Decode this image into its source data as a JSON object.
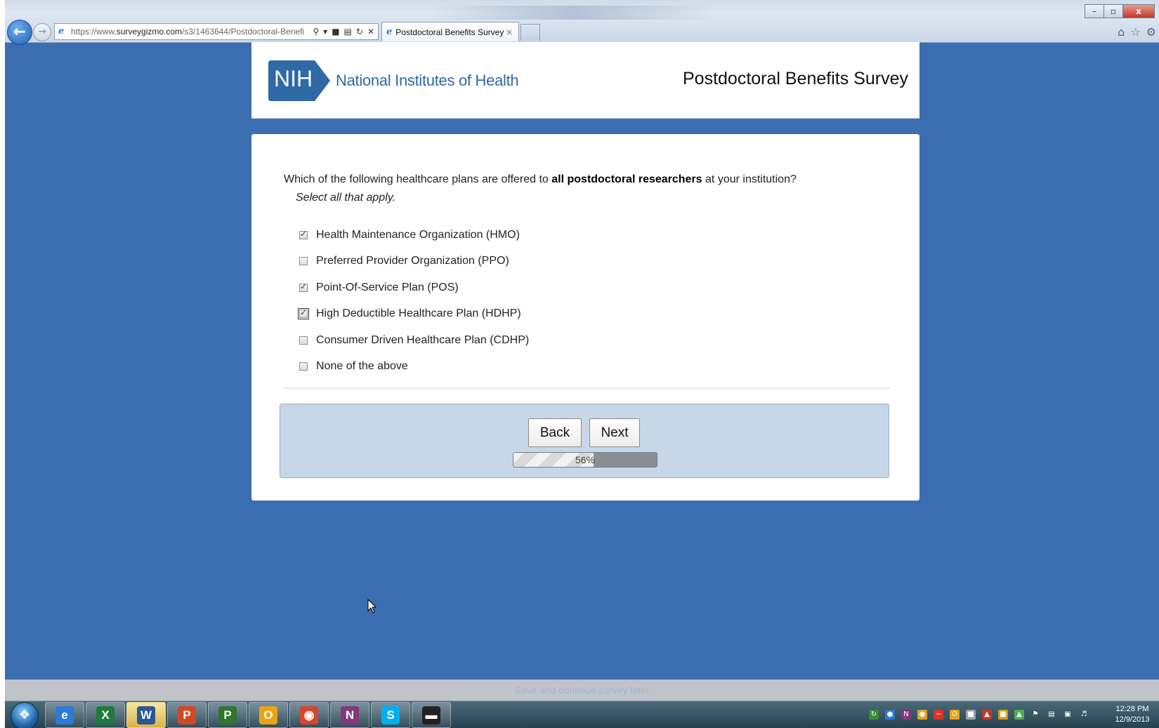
{
  "browser": {
    "url_prefix": "https://www.",
    "url_domain": "surveygizmo.com",
    "url_path": "/s3/1463644/Postdoctoral-Benefi",
    "tab_title": "Postdoctoral Benefits Survey",
    "close_tab_glyph": "×",
    "window_buttons": {
      "minimize": "–",
      "restore": "▫",
      "close": "x"
    }
  },
  "header": {
    "logo_abbrev": "NIH",
    "logo_name": "National Institutes of Health",
    "survey_title": "Postdoctoral Benefits Survey"
  },
  "question": {
    "text_before": "Which of the following healthcare plans are offered to ",
    "text_bold": "all postdoctoral researchers",
    "text_after": " at your institution?",
    "instructions": "Select all that apply.",
    "options": [
      {
        "label": "Health Maintenance Organization (HMO)",
        "checked": true
      },
      {
        "label": "Preferred Provider Organization (PPO)",
        "checked": false
      },
      {
        "label": "Point-Of-Service Plan (POS)",
        "checked": true
      },
      {
        "label": "High Deductible Healthcare Plan (HDHP)",
        "checked": true,
        "focused": true
      },
      {
        "label": "Consumer Driven Healthcare Plan (CDHP)",
        "checked": false
      },
      {
        "label": "None of the above",
        "checked": false
      }
    ]
  },
  "navigation": {
    "back_label": "Back",
    "next_label": "Next",
    "progress_percent": 56,
    "progress_text": "56%"
  },
  "footer": {
    "save_link": "Save and continue survey later"
  },
  "taskbar": {
    "apps": [
      {
        "name": "internet-explorer",
        "glyph": "e",
        "color": "#2d7ad6",
        "active": false
      },
      {
        "name": "excel",
        "glyph": "X",
        "color": "#1e7b3c",
        "active": false
      },
      {
        "name": "word",
        "glyph": "W",
        "color": "#2b5797",
        "active": true
      },
      {
        "name": "powerpoint",
        "glyph": "P",
        "color": "#d24726",
        "active": false
      },
      {
        "name": "project",
        "glyph": "P",
        "color": "#31752f",
        "active": false
      },
      {
        "name": "outlook",
        "glyph": "O",
        "color": "#e8a317",
        "active": false
      },
      {
        "name": "chrome",
        "glyph": "◉",
        "color": "#d64532",
        "active": false
      },
      {
        "name": "onenote",
        "glyph": "N",
        "color": "#80397b",
        "active": false
      },
      {
        "name": "skype",
        "glyph": "S",
        "color": "#00aff0",
        "active": false
      },
      {
        "name": "amazon-app",
        "glyph": "▬",
        "color": "#222222",
        "active": false
      }
    ],
    "clock_time": "12:28 PM",
    "clock_date": "12/9/2013"
  },
  "colors": {
    "page_background": "#3b6eb0",
    "nih_blue": "#2d6aa6",
    "nav_area": "#c8d7e8"
  }
}
